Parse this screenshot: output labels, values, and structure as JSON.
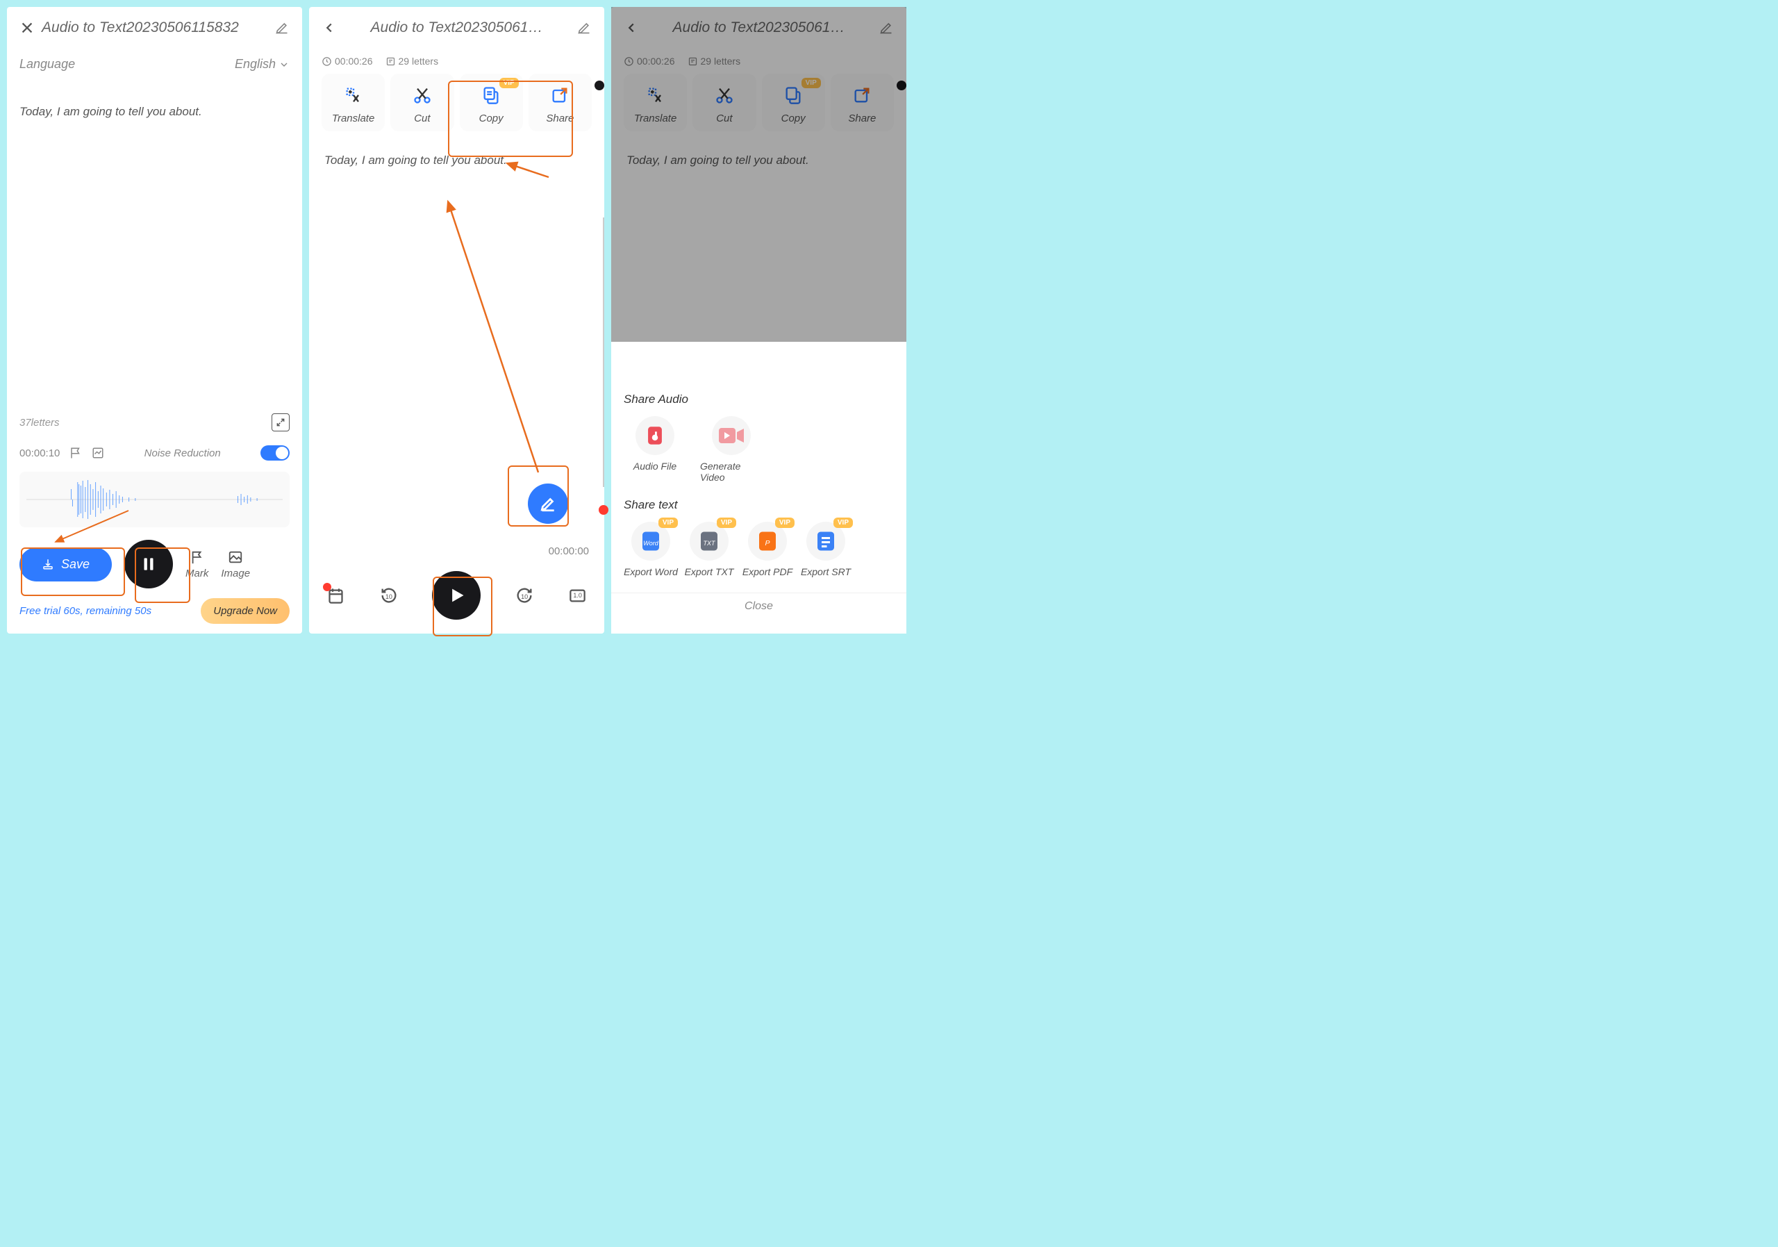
{
  "screen1": {
    "title": "Audio to Text20230506115832",
    "language_label": "Language",
    "language_value": "English",
    "body": "Today, I am going to tell you about.",
    "letters": "37letters",
    "time": "00:00:10",
    "noise_label": "Noise Reduction",
    "save": "Save",
    "mark": "Mark",
    "image": "Image",
    "trial_prefix": "Free trial 60s, remaining",
    "trial_remaining": "50s",
    "upgrade": "Upgrade Now"
  },
  "screen2": {
    "title": "Audio to Text202305061…",
    "duration": "00:00:26",
    "letters": "29 letters",
    "actions": {
      "translate": "Translate",
      "cut": "Cut",
      "copy": "Copy",
      "share": "Share",
      "vip": "VIP"
    },
    "body": "Today, I am going to tell you about.",
    "playtime": "00:00:00"
  },
  "screen3": {
    "title": "Audio to Text202305061…",
    "duration": "00:00:26",
    "letters": "29 letters",
    "actions": {
      "translate": "Translate",
      "cut": "Cut",
      "copy": "Copy",
      "share": "Share",
      "vip": "VIP"
    },
    "body": "Today, I am going to tell you about.",
    "sheet": {
      "share_audio": "Share Audio",
      "audio_file": "Audio File",
      "generate_video": "Generate Video",
      "share_text": "Share text",
      "export_word": "Export Word",
      "export_txt": "Export TXT",
      "export_pdf": "Export PDF",
      "export_srt": "Export SRT",
      "vip": "VIP",
      "close": "Close"
    }
  }
}
